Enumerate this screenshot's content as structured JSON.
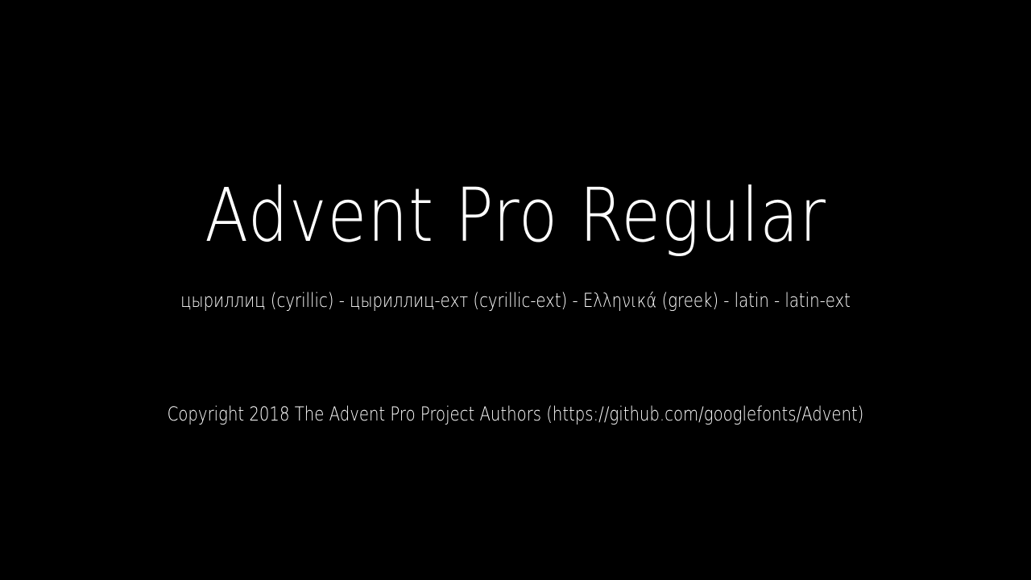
{
  "font_specimen": {
    "title": "Advent Pro Regular",
    "subsets": "цыриллиц (cyrillic) - цыриллиц-ехт (cyrillic-ext) - Ελληνικά (greek) - latin - latin-ext",
    "copyright": "Copyright 2018 The Advent Pro Project Authors (https://github.com/googlefonts/Advent)"
  },
  "colors": {
    "background": "#000000",
    "text": "#ffffff"
  }
}
